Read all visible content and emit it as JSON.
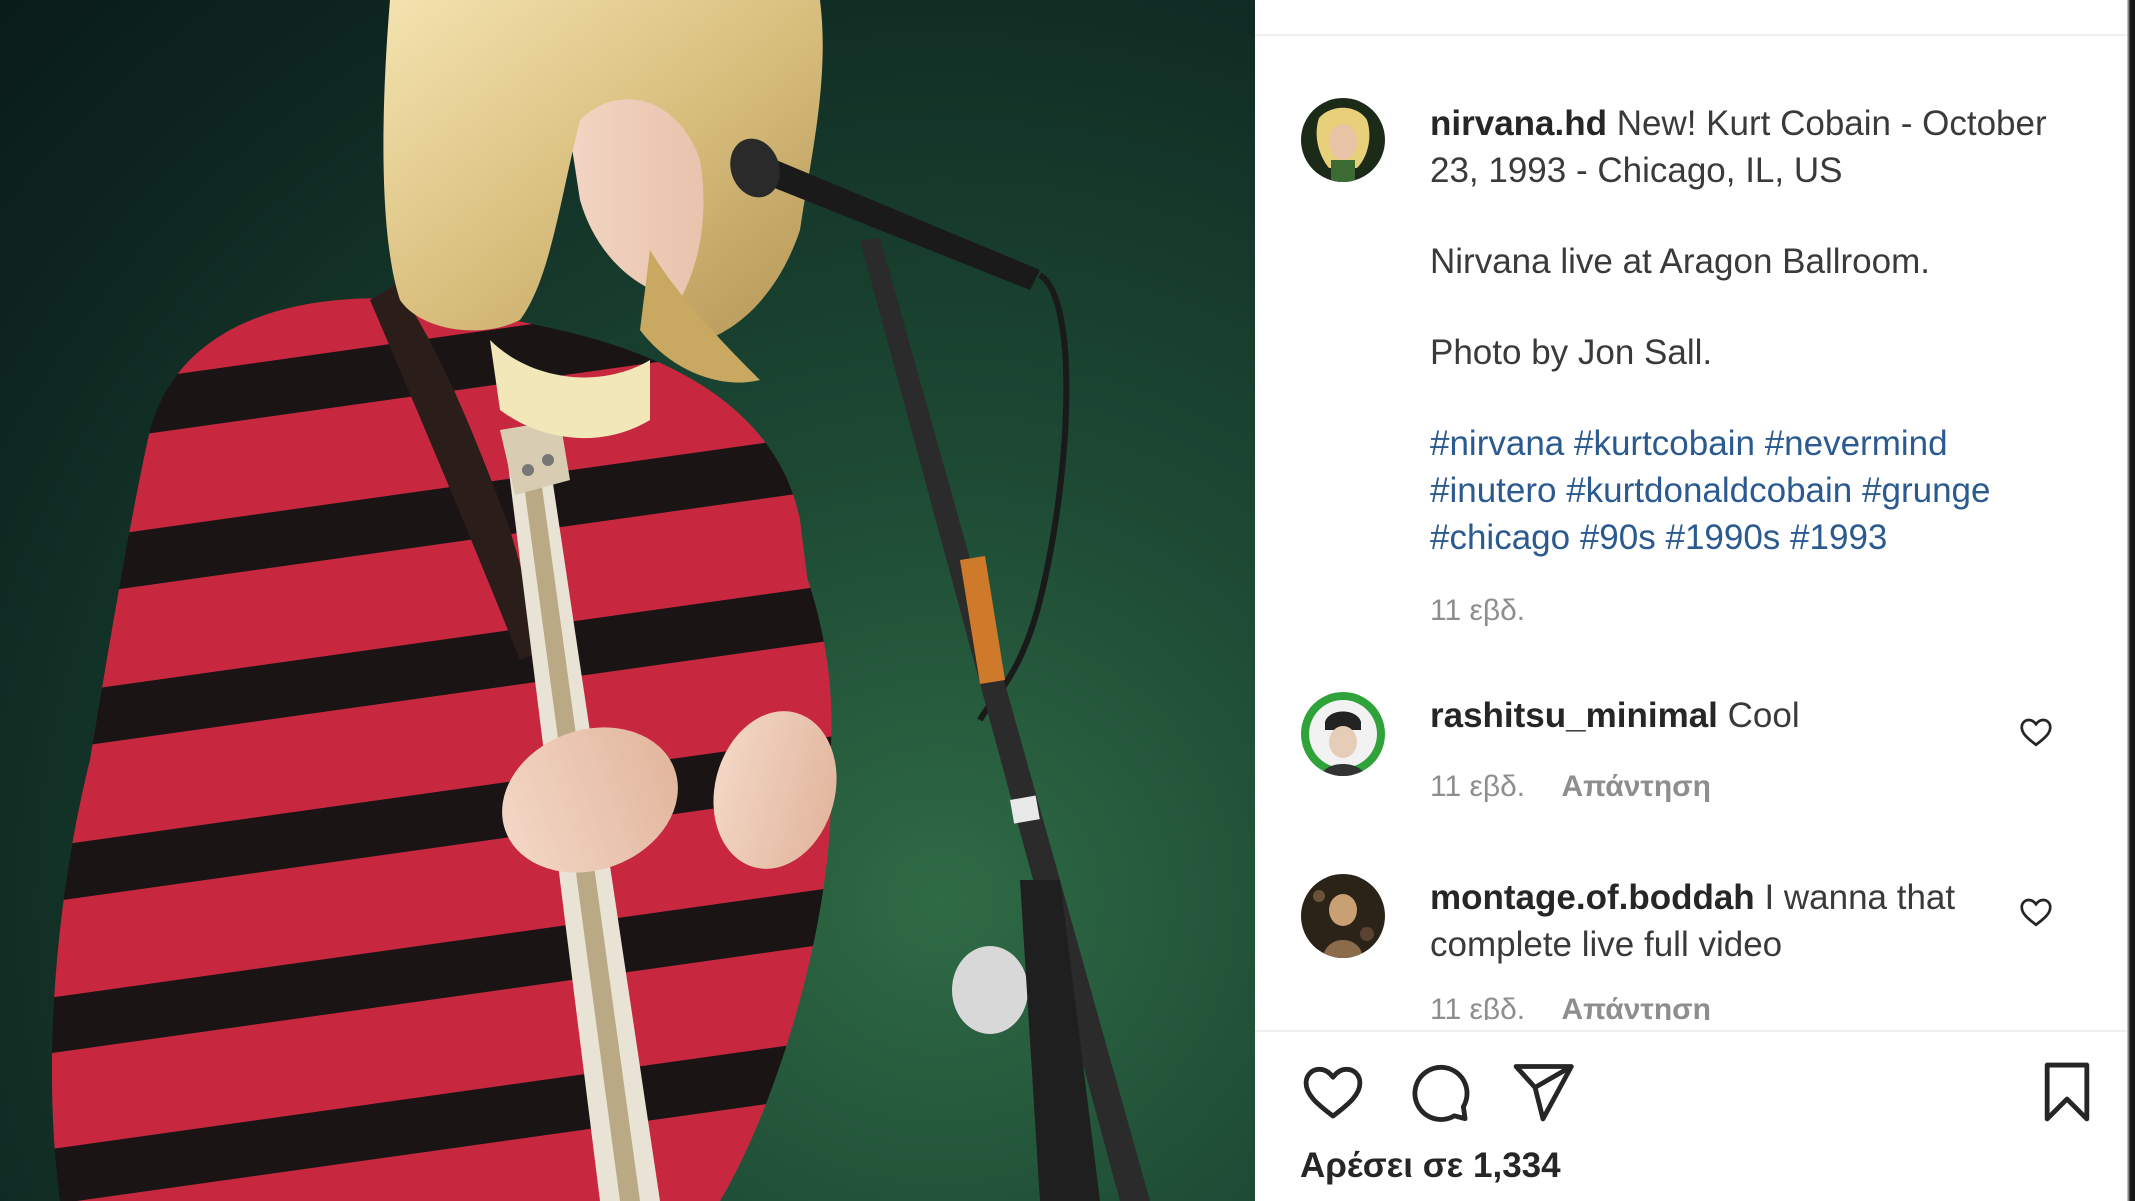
{
  "post": {
    "username": "nirvana.hd",
    "caption_title": "New! Kurt Cobain - October 23, 1993 - Chicago, IL, US",
    "caption_line2": "Nirvana live at Aragon Ballroom.",
    "caption_line3": "Photo by Jon Sall.",
    "hashtags": [
      "#nirvana",
      "#kurtcobain",
      "#nevermind",
      "#inutero",
      "#kurtdonaldcobain",
      "#grunge",
      "#chicago",
      "#90s",
      "#1990s",
      "#1993"
    ],
    "timestamp": "11 εβδ."
  },
  "comments": [
    {
      "username": "rashitsu_minimal",
      "text": "Cool",
      "timestamp": "11 εβδ.",
      "reply_label": "Απάντηση"
    },
    {
      "username": "montage.of.boddah",
      "text": "I wanna that complete live full video",
      "timestamp": "11 εβδ.",
      "reply_label": "Απάντηση"
    }
  ],
  "actions": {
    "like_icon": "heart-outline-icon",
    "comment_icon": "speech-bubble-icon",
    "share_icon": "paper-plane-icon",
    "save_icon": "bookmark-outline-icon"
  },
  "likes_text": "Αρέσει σε 1,334",
  "colors": {
    "text_primary": "#262626",
    "text_secondary": "#8e8e8e",
    "hashtag": "#2a5a8f"
  }
}
